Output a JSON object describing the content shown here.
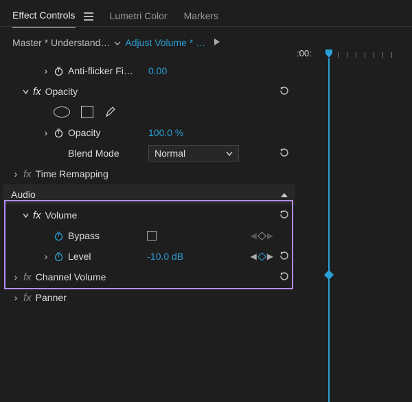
{
  "tabs": {
    "effect_controls": "Effect Controls",
    "lumetri": "Lumetri Color",
    "markers": "Markers"
  },
  "sourcebar": {
    "master": "Master * Understand…",
    "clip": "Adjust Volume * …"
  },
  "timeline": {
    "timecode": ":00:"
  },
  "effects": {
    "antiflicker": {
      "label": "Anti-flicker Fi…",
      "value": "0.00"
    },
    "opacity_group": "Opacity",
    "opacity_prop": {
      "label": "Opacity",
      "value": "100.0 %"
    },
    "blend": {
      "label": "Blend Mode",
      "value": "Normal"
    },
    "time_remap": "Time Remapping"
  },
  "audio": {
    "section": "Audio",
    "volume": "Volume",
    "bypass": {
      "label": "Bypass"
    },
    "level": {
      "label": "Level",
      "value": "-10.0 dB"
    },
    "channel_volume": "Channel Volume",
    "panner": "Panner"
  }
}
